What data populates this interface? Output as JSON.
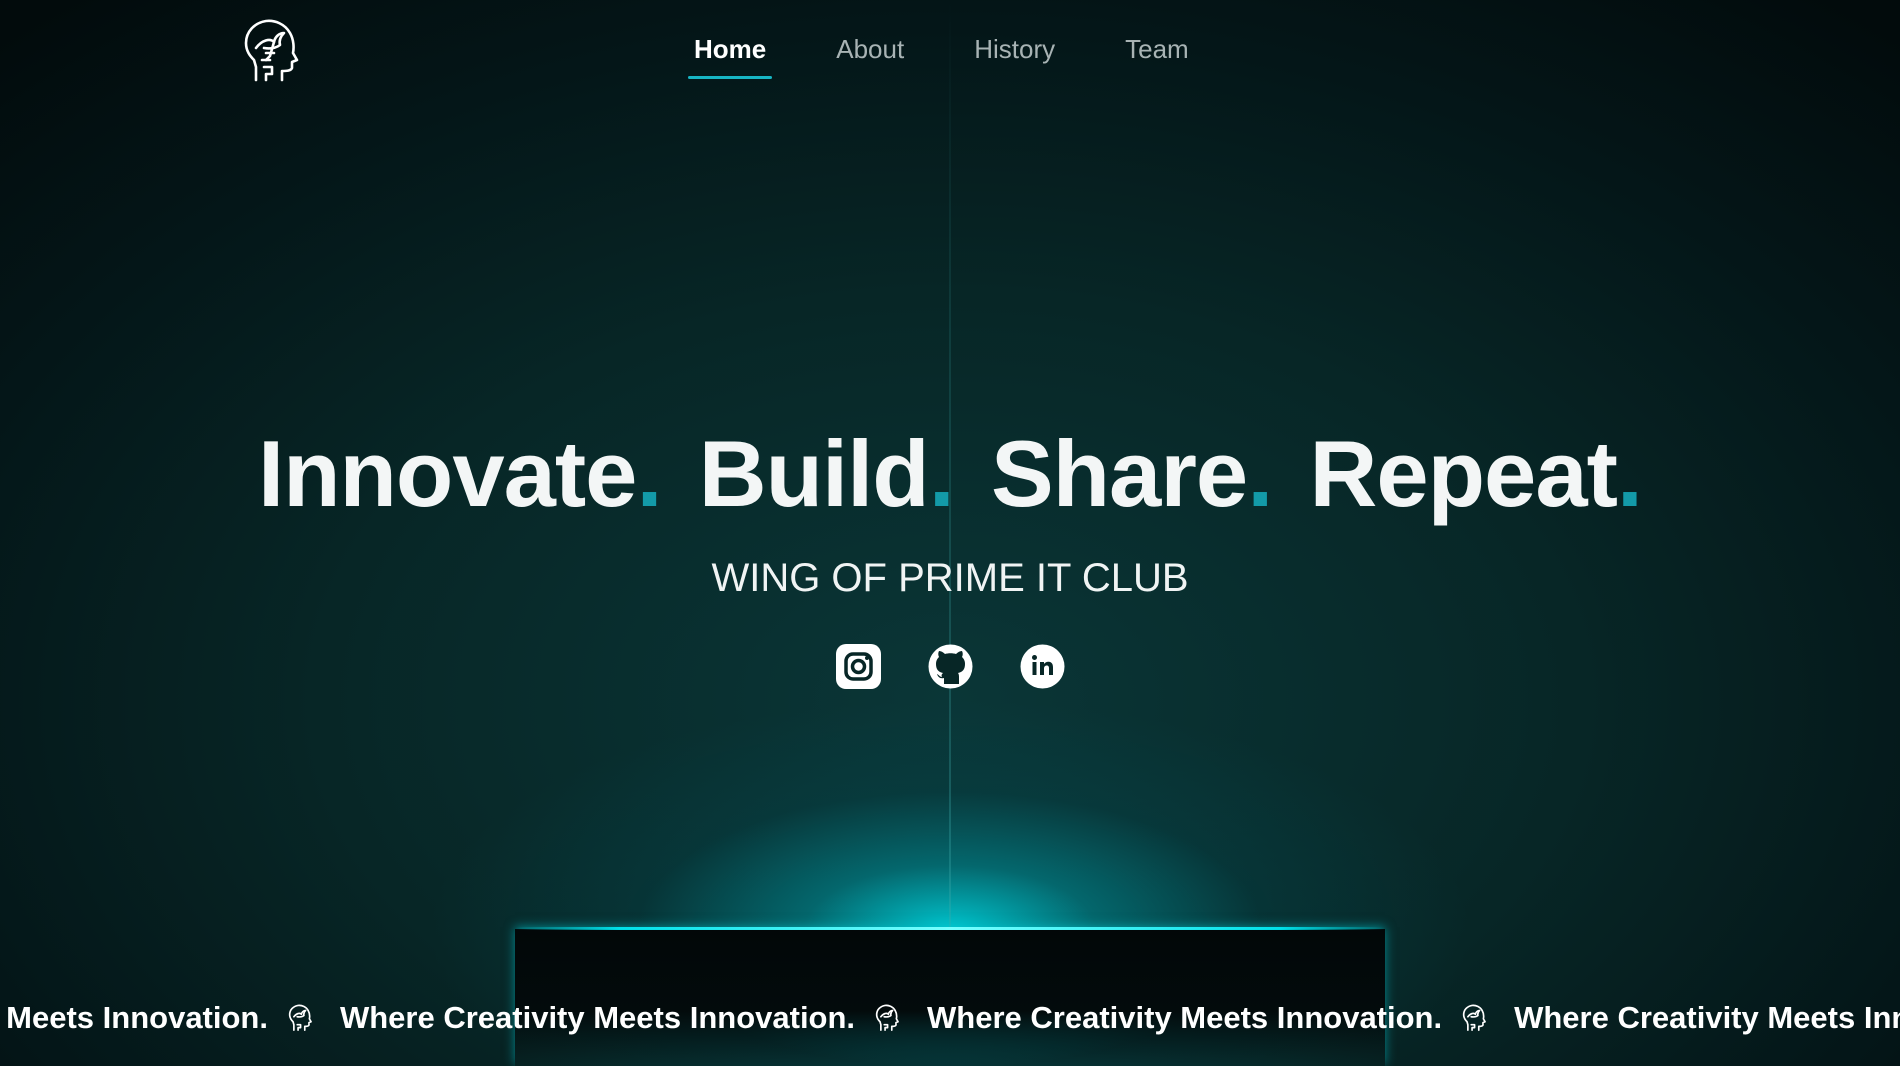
{
  "header": {
    "logo": {
      "icon": "head-bird-logo-icon",
      "label": ""
    },
    "nav": [
      {
        "label": "Home",
        "active": true
      },
      {
        "label": "About",
        "active": false
      },
      {
        "label": "History",
        "active": false
      },
      {
        "label": "Team",
        "active": false
      }
    ]
  },
  "hero": {
    "words": [
      "Innovate",
      "Build",
      "Share",
      "Repeat"
    ],
    "dot": ".",
    "subtitle": "WING OF PRIME IT CLUB",
    "socials": [
      {
        "name": "instagram",
        "icon": "instagram-icon"
      },
      {
        "name": "github",
        "icon": "github-icon"
      },
      {
        "name": "linkedin",
        "icon": "linkedin-icon"
      }
    ]
  },
  "marquee": {
    "first_fragment": "ty Meets Innovation.",
    "text": "Where Creativity Meets Innovation.",
    "last_fragment": "Where Creativity Meets Innova",
    "icon": "head-bird-logo-icon"
  },
  "colors": {
    "accent": "#17b5c4",
    "dot": "#139aa8",
    "glow": "#00d2dc",
    "background": "#041618",
    "text": "#f3f6f6",
    "nav_inactive": "#a8b3b4"
  }
}
